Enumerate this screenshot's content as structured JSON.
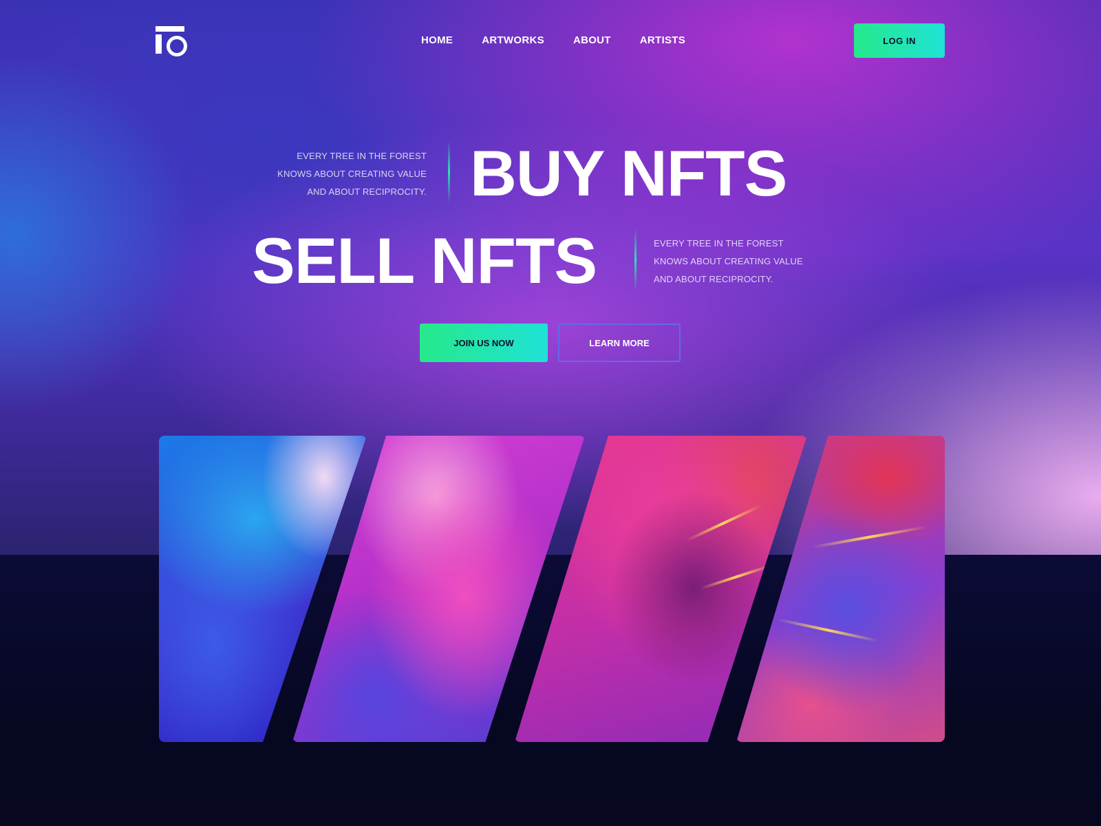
{
  "nav": {
    "items": [
      "HOME",
      "ARTWORKS",
      "ABOUT",
      "ARTISTS"
    ],
    "login_label": "LOG IN"
  },
  "hero": {
    "tagline_1": [
      "EVERY TREE IN THE FOREST",
      "KNOWS ABOUT CREATING VALUE",
      "AND ABOUT RECIPROCITY."
    ],
    "headline_1": "BUY NFTS",
    "headline_2": "SELL NFTS",
    "tagline_2": [
      "EVERY TREE IN THE FOREST",
      "KNOWS ABOUT CREATING VALUE",
      "AND ABOUT RECIPROCITY."
    ],
    "join_label": "JOIN US NOW",
    "learn_label": "LEARN MORE"
  },
  "colors": {
    "accent_green": "#26e98a",
    "accent_cyan": "#1fe2d6",
    "background_dark": "#050722"
  },
  "icons": {
    "logo": "logo-icon"
  }
}
